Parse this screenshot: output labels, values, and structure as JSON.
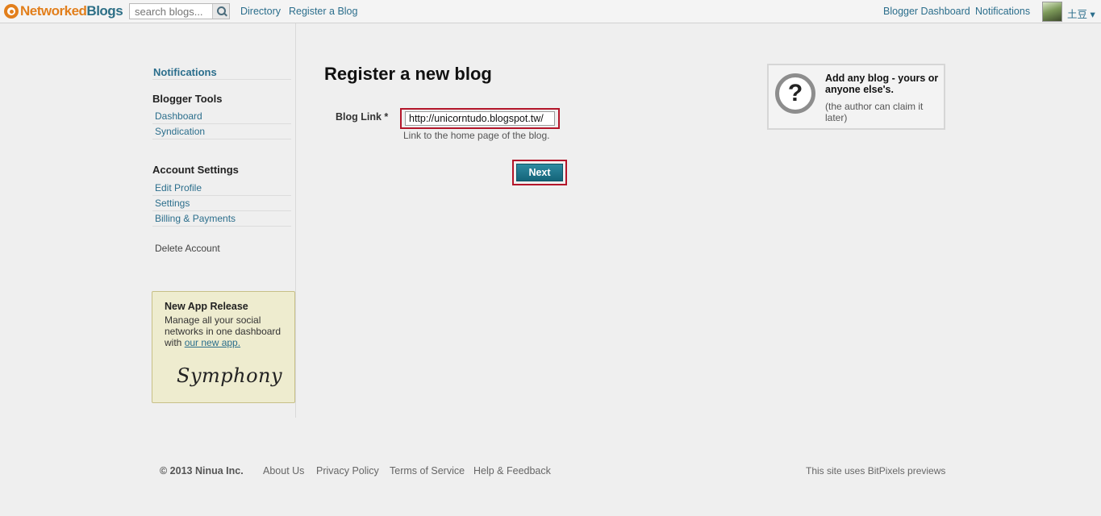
{
  "topbar": {
    "logo_part1": "Networked",
    "logo_part2": "Blogs",
    "search_placeholder": "search blogs...",
    "nav": [
      "Directory",
      "Register a Blog"
    ],
    "right_nav": [
      "Blogger Dashboard",
      "Notifications"
    ],
    "user_name": "土豆 ▾"
  },
  "sidebar": {
    "notifications": "Notifications",
    "blogger_tools": {
      "heading": "Blogger Tools",
      "items": [
        "Dashboard",
        "Syndication"
      ]
    },
    "account_settings": {
      "heading": "Account Settings",
      "items": [
        "Edit Profile",
        "Settings",
        "Billing & Payments"
      ]
    },
    "delete_account": "Delete Account",
    "promo": {
      "title": "New App Release",
      "body": "Manage all your social networks in one dashboard with ",
      "link": "our new app.",
      "signature": "Symphony"
    }
  },
  "main": {
    "title": "Register a new blog",
    "field_label": "Blog Link *",
    "field_value": "http://unicorntudo.blogspot.tw/",
    "field_hint": "Link to the home page of the blog.",
    "next_label": "Next"
  },
  "help": {
    "icon": "?",
    "title": "Add any blog - yours or anyone else's.",
    "subtitle": "(the author can claim it later)"
  },
  "footer": {
    "copyright": "© 2013 Ninua Inc.",
    "links": [
      "About Us",
      "Privacy Policy",
      "Terms of Service",
      "Help & Feedback"
    ],
    "right_text": "This site uses BitPixels previews"
  },
  "colors": {
    "accent_orange": "#e27f1c",
    "link_blue": "#2b6e8c",
    "highlight_red": "#b3162a",
    "button_teal": "#146479"
  }
}
